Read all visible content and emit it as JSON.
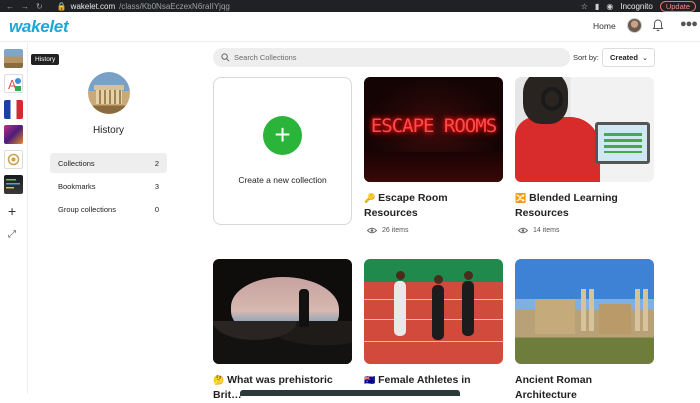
{
  "browser": {
    "host": "wakelet.com",
    "path": "/class/Kb0NsaEczexN6raIIYjqg",
    "incognito_label": "Incognito",
    "update_label": "Update"
  },
  "header": {
    "logo": "wakelet",
    "home_link": "Home"
  },
  "tooltip": "History",
  "profile": {
    "name": "History"
  },
  "sidebar": {
    "items": [
      {
        "label": "Collections",
        "count": "2"
      },
      {
        "label": "Bookmarks",
        "count": "3"
      },
      {
        "label": "Group collections",
        "count": "0"
      }
    ]
  },
  "search": {
    "placeholder": "Search Collections"
  },
  "sort": {
    "label": "Sort by:",
    "value": "Created"
  },
  "create_card": {
    "label": "Create a new collection"
  },
  "cards": [
    {
      "emoji": "🔑",
      "title": "Escape Room Resources",
      "items": "26 items",
      "image_text": "ESCAPE ROOMS"
    },
    {
      "emoji": "🔀",
      "title": "Blended Learning Resources",
      "items": "14 items"
    },
    {
      "emoji": "🤔",
      "title": "What was prehistoric Brit…"
    },
    {
      "emoji": "🇦🇺",
      "title": "Female Athletes in"
    },
    {
      "emoji": "",
      "title": "Ancient Roman Architecture"
    }
  ]
}
